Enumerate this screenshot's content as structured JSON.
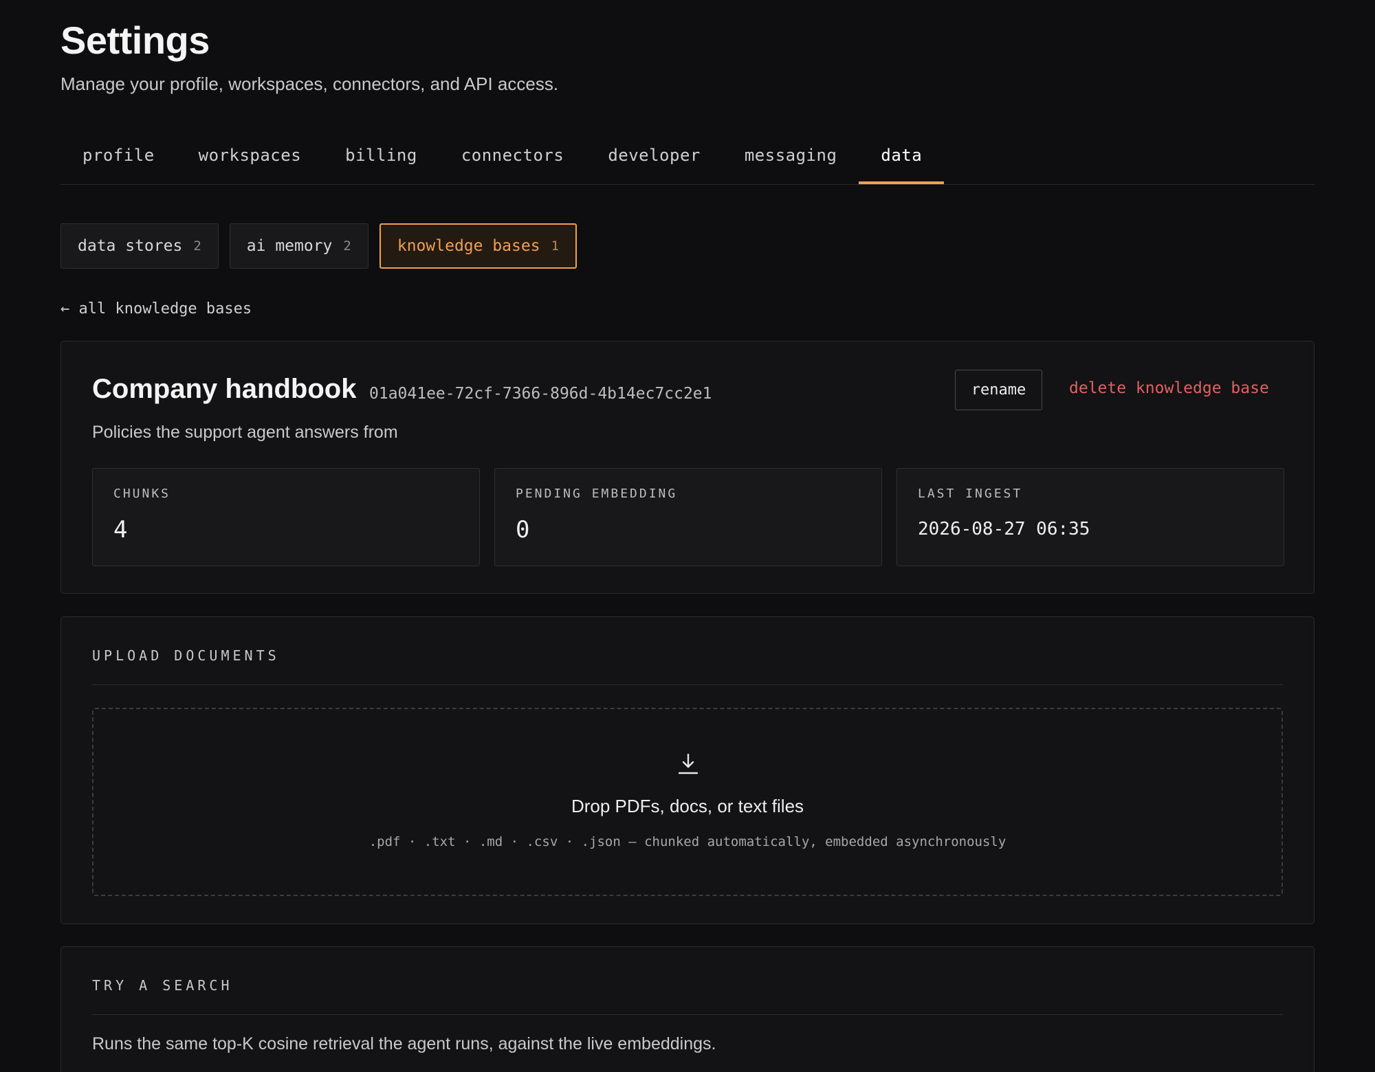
{
  "header": {
    "title": "Settings",
    "subtitle": "Manage your profile, workspaces, connectors, and API access."
  },
  "tabs": [
    {
      "label": "profile",
      "active": false
    },
    {
      "label": "workspaces",
      "active": false
    },
    {
      "label": "billing",
      "active": false
    },
    {
      "label": "connectors",
      "active": false
    },
    {
      "label": "developer",
      "active": false
    },
    {
      "label": "messaging",
      "active": false
    },
    {
      "label": "data",
      "active": true
    }
  ],
  "subtabs": [
    {
      "label": "data stores",
      "count": "2",
      "active": false
    },
    {
      "label": "ai memory",
      "count": "2",
      "active": false
    },
    {
      "label": "knowledge bases",
      "count": "1",
      "active": true
    }
  ],
  "back_link": "← all knowledge bases",
  "knowledge_base": {
    "name": "Company handbook",
    "id": "01a041ee-72cf-7366-896d-4b14ec7cc2e1",
    "description": "Policies the support agent answers from",
    "rename_label": "rename",
    "delete_label": "delete knowledge base",
    "stats": {
      "chunks": {
        "label": "CHUNKS",
        "value": "4"
      },
      "pending": {
        "label": "PENDING EMBEDDING",
        "value": "0"
      },
      "last_ingest": {
        "label": "LAST INGEST",
        "value": "2026-08-27 06:35"
      }
    }
  },
  "upload": {
    "heading": "UPLOAD DOCUMENTS",
    "icon": "download-icon",
    "title": "Drop PDFs, docs, or text files",
    "hint": ".pdf · .txt · .md · .csv · .json — chunked automatically, embedded asynchronously"
  },
  "search": {
    "heading": "TRY A SEARCH",
    "description": "Runs the same top-K cosine retrieval the agent runs, against the live embeddings."
  },
  "colors": {
    "background": "#0e0e10",
    "accent": "#f0a050",
    "danger": "#e36060",
    "card": "#131316"
  }
}
